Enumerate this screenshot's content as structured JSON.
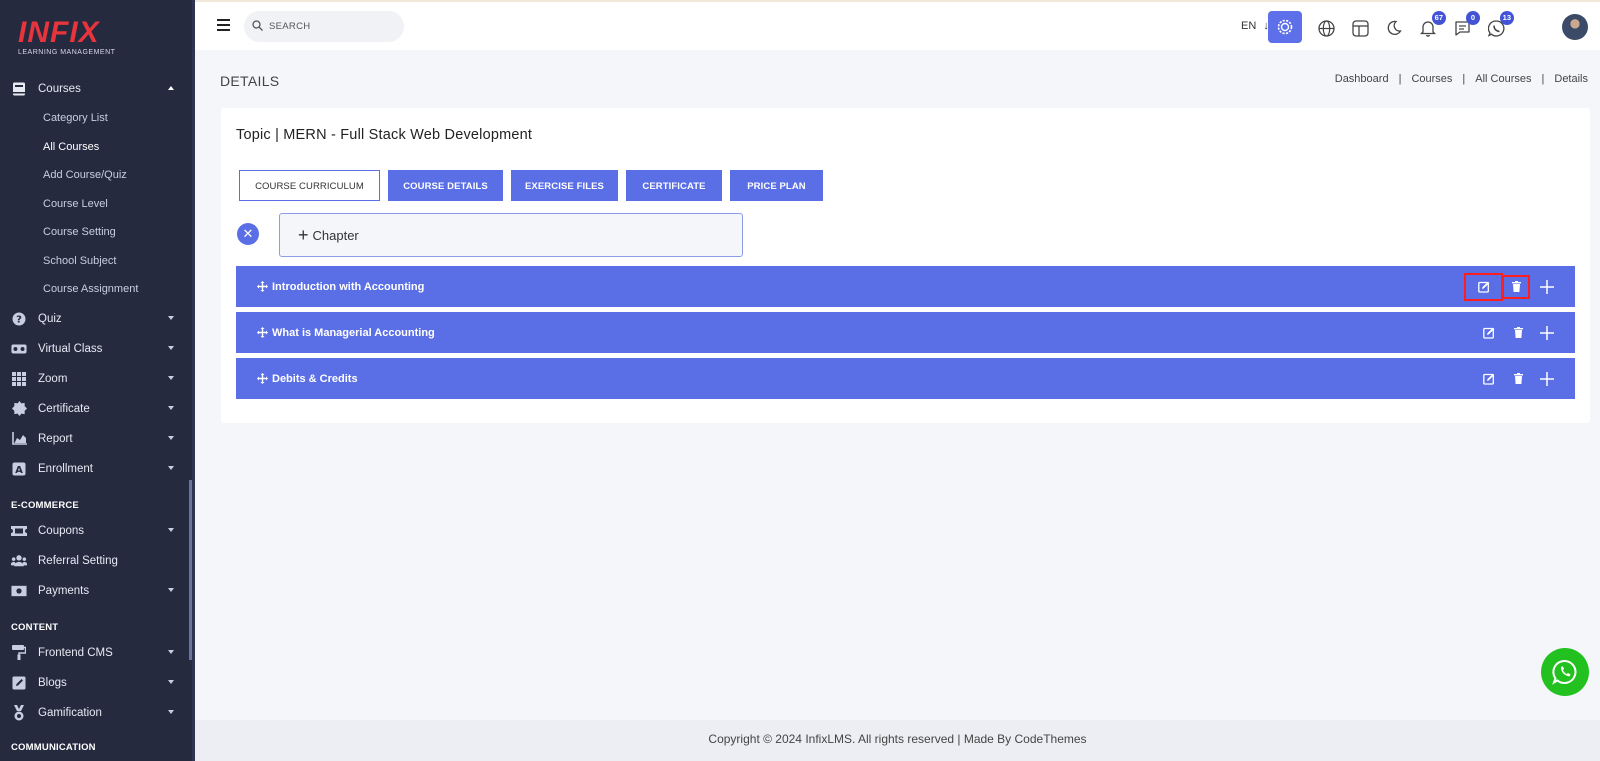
{
  "brand": {
    "logo_text": "INFIX",
    "logo_sub": "LEARNING MANAGEMENT"
  },
  "sidebar": {
    "courses": {
      "label": "Courses",
      "sub_items": [
        "Category List",
        "All Courses",
        "Add Course/Quiz",
        "Course Level",
        "Course Setting",
        "School Subject",
        "Course Assignment"
      ],
      "active": "All Courses"
    },
    "items": [
      {
        "label": "Quiz",
        "icon": "question-circle-icon"
      },
      {
        "label": "Virtual Class",
        "icon": "vr-headset-icon"
      },
      {
        "label": "Zoom",
        "icon": "grid-icon"
      },
      {
        "label": "Certificate",
        "icon": "certificate-icon"
      },
      {
        "label": "Report",
        "icon": "area-chart-icon"
      },
      {
        "label": "Enrollment",
        "icon": "enrollment-icon"
      }
    ],
    "ecommerce_title": "E-COMMERCE",
    "ecommerce_items": [
      {
        "label": "Coupons",
        "icon": "ticket-icon"
      },
      {
        "label": "Referral Setting",
        "icon": "users-icon"
      },
      {
        "label": "Payments",
        "icon": "money-icon"
      }
    ],
    "content_title": "CONTENT",
    "content_items": [
      {
        "label": "Frontend CMS",
        "icon": "paint-roller-icon"
      },
      {
        "label": "Blogs",
        "icon": "edit-square-icon"
      },
      {
        "label": "Gamification",
        "icon": "medal-icon"
      }
    ],
    "communication_title": "COMMUNICATION"
  },
  "header": {
    "search_placeholder": "SEARCH",
    "language": "EN",
    "notifications_count": "67",
    "messages_count": "0",
    "whatsapp_count": "13"
  },
  "page": {
    "title": "DETAILS",
    "breadcrumb": [
      "Dashboard",
      "Courses",
      "All Courses",
      "Details"
    ]
  },
  "card": {
    "title": "Topic | MERN - Full Stack Web Development",
    "tabs": [
      "COURSE CURRICULUM",
      "COURSE DETAILS",
      "EXERCISE FILES",
      "CERTIFICATE",
      "PRICE PLAN"
    ],
    "active_tab": "COURSE CURRICULUM",
    "chapter_button": "Chapter",
    "chapters": [
      "Introduction with Accounting",
      "What is Managerial Accounting",
      "Debits & Credits"
    ]
  },
  "footer": {
    "text": "Copyright © 2024 InfixLMS. All rights reserved | Made By CodeThemes"
  },
  "colors": {
    "sidebar_bg": "#252a3f",
    "accent": "#5a6ee6",
    "highlight": "#ff1e1e",
    "whatsapp": "#22c11f"
  }
}
